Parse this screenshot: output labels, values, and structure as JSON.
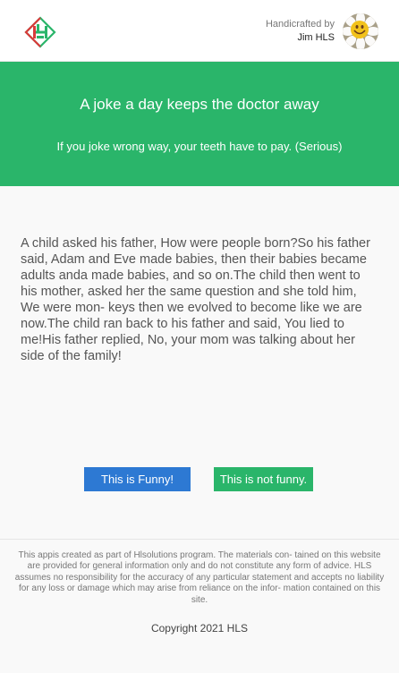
{
  "header": {
    "credit_label": "Handicrafted by",
    "author_name": "Jim HLS",
    "logo_icon": "hls-diamond-logo-icon",
    "avatar_icon": "flower-smiley-avatar-icon"
  },
  "banner": {
    "title": "A joke a day keeps the doctor away",
    "subtitle": "If you joke wrong way, your teeth have to pay. (Serious)",
    "color": "#2ab56a"
  },
  "joke": {
    "text": "A child asked his father, How were people born?So his father said, Adam and Eve made babies, then their babies became adults anda made babies, and so on.The child then went to his mother, asked her the same question and she told him, We were mon- keys then we evolved to become like we are now.The child ran back to his father and said, You lied to me!His father replied, No, your mom was talking about her side of the family!"
  },
  "buttons": {
    "funny_label": "This is Funny!",
    "not_funny_label": "This is not funny.",
    "funny_color": "#2d79d3",
    "not_funny_color": "#2ab56a"
  },
  "footer": {
    "disclaimer": "This appis created as part of Hlsolutions program. The materials con- tained on this website are provided for general information only and do not constitute any form of advice. HLS assumes no responsibility for the accuracy of any particular statement and accepts no liability for any loss or damage which may arise from reliance on the infor- mation contained on this site.",
    "copyright": "Copyright 2021 HLS"
  }
}
